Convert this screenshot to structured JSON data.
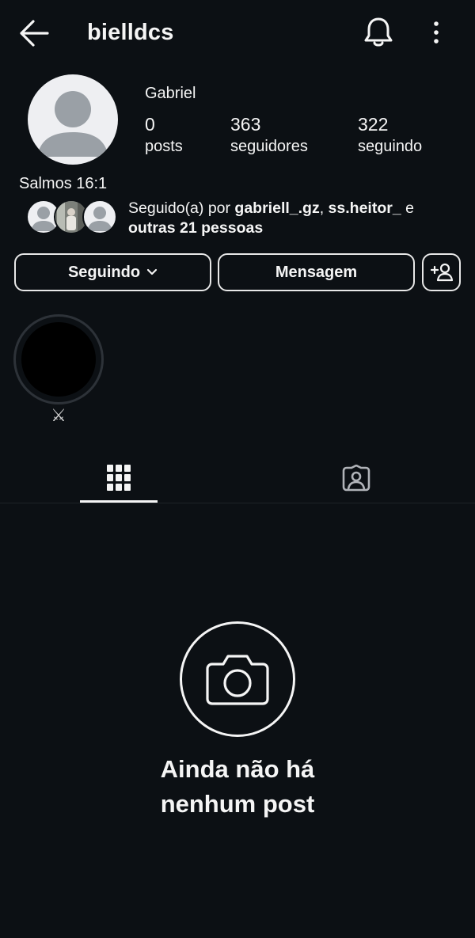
{
  "header": {
    "username": "bielldcs",
    "back_icon": "back-arrow-icon",
    "notification_icon": "bell-icon",
    "more_icon": "more-vertical-icon"
  },
  "profile": {
    "display_name": "Gabriel",
    "stats": [
      {
        "value": "0",
        "label": "posts"
      },
      {
        "value": "363",
        "label": "seguidores"
      },
      {
        "value": "322",
        "label": "seguindo"
      }
    ],
    "bio": "Salmos 16:1"
  },
  "followed_by": {
    "prefix": "Seguido(a) por ",
    "user1": "gabriell_.gz",
    "separator": ", ",
    "user2": "ss.heitor_",
    "conjunction": " e",
    "others": "outras 21 pessoas"
  },
  "actions": {
    "following_label": "Seguindo",
    "message_label": "Mensagem",
    "add_user_icon": "add-user-icon"
  },
  "highlights": [
    {
      "label": "⚔"
    }
  ],
  "tabs": [
    {
      "name": "posts-grid",
      "icon": "grid-icon",
      "active": true
    },
    {
      "name": "tagged",
      "icon": "tagged-user-icon",
      "active": false
    }
  ],
  "empty_state": {
    "icon": "camera-icon",
    "message": "Ainda não há nenhum post"
  },
  "colors": {
    "background": "#0c1014",
    "text": "#f5f5f5",
    "avatar_placeholder_bg": "#eeeff2",
    "avatar_placeholder_fg": "#9aa0a6",
    "highlight_ring": "#2d3238"
  }
}
